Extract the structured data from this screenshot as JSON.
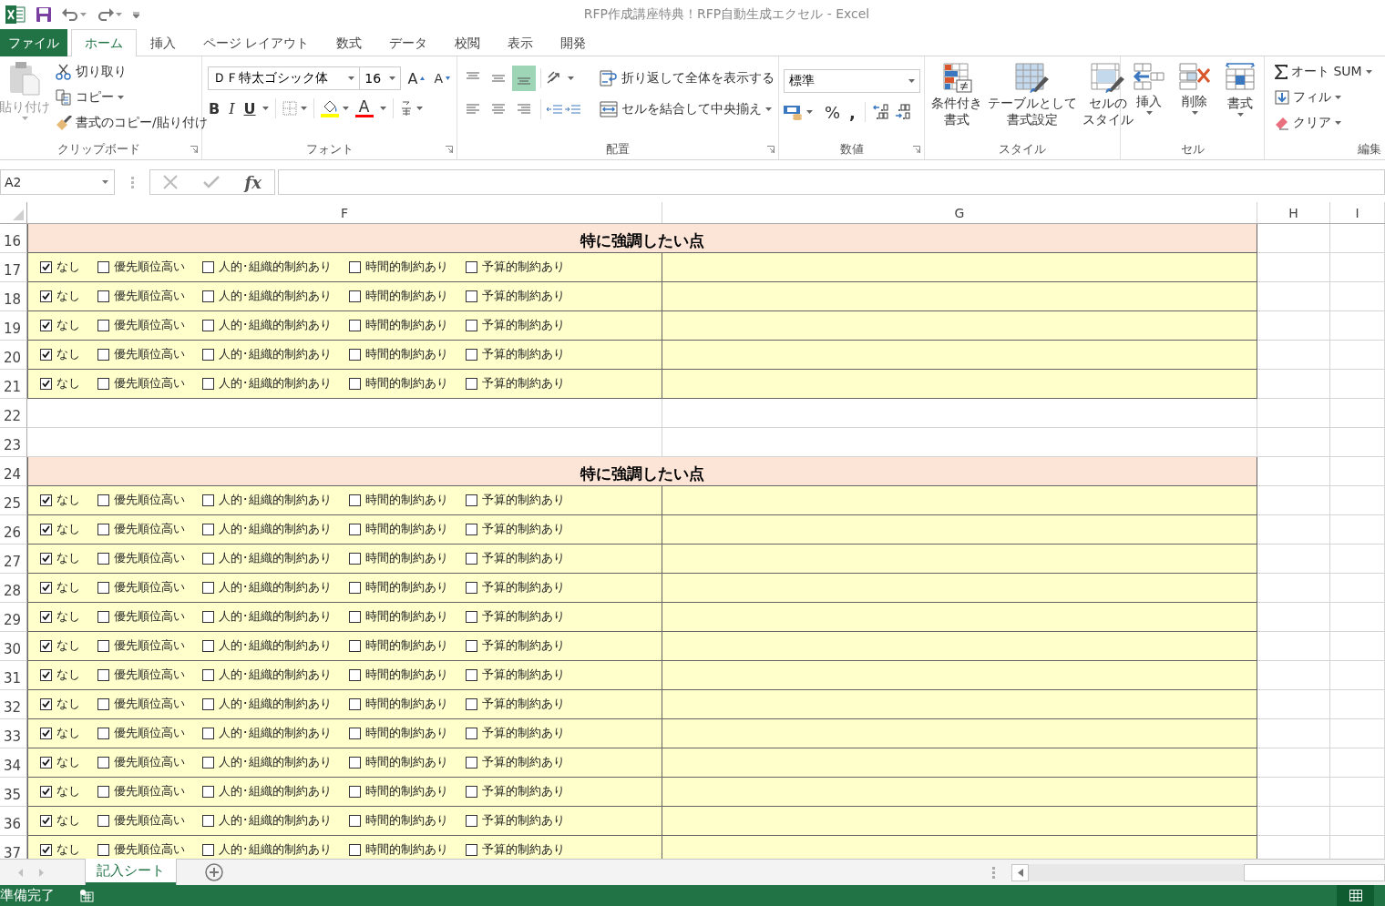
{
  "title_bar": {
    "title": "RFP作成講座特典！RFP自動生成エクセル - Excel"
  },
  "ribbon_tabs": [
    {
      "label": "ファイル",
      "kind": "file",
      "selected": false
    },
    {
      "label": "ホーム",
      "kind": "tab",
      "selected": true
    },
    {
      "label": "挿入",
      "kind": "tab",
      "selected": false
    },
    {
      "label": "ページ レイアウト",
      "kind": "tab",
      "selected": false
    },
    {
      "label": "数式",
      "kind": "tab",
      "selected": false
    },
    {
      "label": "データ",
      "kind": "tab",
      "selected": false
    },
    {
      "label": "校閲",
      "kind": "tab",
      "selected": false
    },
    {
      "label": "表示",
      "kind": "tab",
      "selected": false
    },
    {
      "label": "開発",
      "kind": "tab",
      "selected": false
    }
  ],
  "ribbon": {
    "clipboard": {
      "paste": {
        "label": "貼り付け",
        "disabled": true
      },
      "cut": "切り取り",
      "copy": "コピー",
      "format_painter": "書式のコピー/貼り付け",
      "label": "クリップボード"
    },
    "font": {
      "font_name": "ＤＦ特太ゴシック体",
      "font_size": "16",
      "grow_font": "A",
      "shrink_font": "A",
      "bold": "B",
      "italic": "I",
      "underline": "U",
      "font_color": "A",
      "label": "フォント"
    },
    "alignment": {
      "vertical_align": [
        {
          "selected": false
        },
        {
          "selected": false
        },
        {
          "selected": true
        }
      ],
      "wrap_text": "折り返して全体を表示する",
      "merge_center": "セルを結合して中央揃え",
      "label": "配置"
    },
    "number": {
      "format": "標準",
      "percent": "%",
      "comma": ",",
      "label": "数値"
    },
    "styles": {
      "buttons": [
        {
          "lines": [
            "条件付き",
            "書式"
          ],
          "kind": "conditional"
        },
        {
          "lines": [
            "テーブルとして",
            "書式設定"
          ],
          "kind": "table"
        },
        {
          "lines": [
            "セルの",
            "スタイル"
          ],
          "kind": "cellstyle"
        }
      ],
      "label": "スタイル"
    },
    "cells": {
      "buttons": [
        {
          "label": "挿入",
          "kind": "insert"
        },
        {
          "label": "削除",
          "kind": "delete"
        },
        {
          "label": "書式",
          "kind": "format"
        }
      ],
      "label": "セル"
    },
    "editing": {
      "autosum": "オート SUM",
      "fill": "フィル",
      "clear": "クリア",
      "label": "編集"
    }
  },
  "formula_bar": {
    "name_box": "A2",
    "function_label": "fx"
  },
  "columns": [
    {
      "label": "F"
    },
    {
      "label": "G"
    },
    {
      "label": "H"
    },
    {
      "label": "I"
    }
  ],
  "rows": [
    {
      "number": "16",
      "kind": "heading",
      "text": "特に強調したい点"
    },
    {
      "number": "17",
      "kind": "checks",
      "options": [
        {
          "label": "なし",
          "checked": true
        },
        {
          "label": "優先順位高い",
          "checked": false
        },
        {
          "label": "人的･組織的制約あり",
          "checked": false
        },
        {
          "label": "時間的制約あり",
          "checked": false
        },
        {
          "label": "予算的制約あり",
          "checked": false
        }
      ]
    },
    {
      "number": "18",
      "kind": "checks",
      "options": [
        {
          "label": "なし",
          "checked": true
        },
        {
          "label": "優先順位高い",
          "checked": false
        },
        {
          "label": "人的･組織的制約あり",
          "checked": false
        },
        {
          "label": "時間的制約あり",
          "checked": false
        },
        {
          "label": "予算的制約あり",
          "checked": false
        }
      ]
    },
    {
      "number": "19",
      "kind": "checks",
      "options": [
        {
          "label": "なし",
          "checked": true
        },
        {
          "label": "優先順位高い",
          "checked": false
        },
        {
          "label": "人的･組織的制約あり",
          "checked": false
        },
        {
          "label": "時間的制約あり",
          "checked": false
        },
        {
          "label": "予算的制約あり",
          "checked": false
        }
      ]
    },
    {
      "number": "20",
      "kind": "checks",
      "options": [
        {
          "label": "なし",
          "checked": true
        },
        {
          "label": "優先順位高い",
          "checked": false
        },
        {
          "label": "人的･組織的制約あり",
          "checked": false
        },
        {
          "label": "時間的制約あり",
          "checked": false
        },
        {
          "label": "予算的制約あり",
          "checked": false
        }
      ]
    },
    {
      "number": "21",
      "kind": "checks",
      "options": [
        {
          "label": "なし",
          "checked": true
        },
        {
          "label": "優先順位高い",
          "checked": false
        },
        {
          "label": "人的･組織的制約あり",
          "checked": false
        },
        {
          "label": "時間的制約あり",
          "checked": false
        },
        {
          "label": "予算的制約あり",
          "checked": false
        }
      ]
    },
    {
      "number": "22",
      "kind": "empty"
    },
    {
      "number": "23",
      "kind": "empty"
    },
    {
      "number": "24",
      "kind": "heading",
      "text": "特に強調したい点"
    },
    {
      "number": "25",
      "kind": "checks",
      "options": [
        {
          "label": "なし",
          "checked": true
        },
        {
          "label": "優先順位高い",
          "checked": false
        },
        {
          "label": "人的･組織的制約あり",
          "checked": false
        },
        {
          "label": "時間的制約あり",
          "checked": false
        },
        {
          "label": "予算的制約あり",
          "checked": false
        }
      ]
    },
    {
      "number": "26",
      "kind": "checks",
      "options": [
        {
          "label": "なし",
          "checked": true
        },
        {
          "label": "優先順位高い",
          "checked": false
        },
        {
          "label": "人的･組織的制約あり",
          "checked": false
        },
        {
          "label": "時間的制約あり",
          "checked": false
        },
        {
          "label": "予算的制約あり",
          "checked": false
        }
      ]
    },
    {
      "number": "27",
      "kind": "checks",
      "options": [
        {
          "label": "なし",
          "checked": true
        },
        {
          "label": "優先順位高い",
          "checked": false
        },
        {
          "label": "人的･組織的制約あり",
          "checked": false
        },
        {
          "label": "時間的制約あり",
          "checked": false
        },
        {
          "label": "予算的制約あり",
          "checked": false
        }
      ]
    },
    {
      "number": "28",
      "kind": "checks",
      "options": [
        {
          "label": "なし",
          "checked": true
        },
        {
          "label": "優先順位高い",
          "checked": false
        },
        {
          "label": "人的･組織的制約あり",
          "checked": false
        },
        {
          "label": "時間的制約あり",
          "checked": false
        },
        {
          "label": "予算的制約あり",
          "checked": false
        }
      ]
    },
    {
      "number": "29",
      "kind": "checks",
      "options": [
        {
          "label": "なし",
          "checked": true
        },
        {
          "label": "優先順位高い",
          "checked": false
        },
        {
          "label": "人的･組織的制約あり",
          "checked": false
        },
        {
          "label": "時間的制約あり",
          "checked": false
        },
        {
          "label": "予算的制約あり",
          "checked": false
        }
      ]
    },
    {
      "number": "30",
      "kind": "checks",
      "options": [
        {
          "label": "なし",
          "checked": true
        },
        {
          "label": "優先順位高い",
          "checked": false
        },
        {
          "label": "人的･組織的制約あり",
          "checked": false
        },
        {
          "label": "時間的制約あり",
          "checked": false
        },
        {
          "label": "予算的制約あり",
          "checked": false
        }
      ]
    },
    {
      "number": "31",
      "kind": "checks",
      "options": [
        {
          "label": "なし",
          "checked": true
        },
        {
          "label": "優先順位高い",
          "checked": false
        },
        {
          "label": "人的･組織的制約あり",
          "checked": false
        },
        {
          "label": "時間的制約あり",
          "checked": false
        },
        {
          "label": "予算的制約あり",
          "checked": false
        }
      ]
    },
    {
      "number": "32",
      "kind": "checks",
      "options": [
        {
          "label": "なし",
          "checked": true
        },
        {
          "label": "優先順位高い",
          "checked": false
        },
        {
          "label": "人的･組織的制約あり",
          "checked": false
        },
        {
          "label": "時間的制約あり",
          "checked": false
        },
        {
          "label": "予算的制約あり",
          "checked": false
        }
      ]
    },
    {
      "number": "33",
      "kind": "checks",
      "options": [
        {
          "label": "なし",
          "checked": true
        },
        {
          "label": "優先順位高い",
          "checked": false
        },
        {
          "label": "人的･組織的制約あり",
          "checked": false
        },
        {
          "label": "時間的制約あり",
          "checked": false
        },
        {
          "label": "予算的制約あり",
          "checked": false
        }
      ]
    },
    {
      "number": "34",
      "kind": "checks",
      "options": [
        {
          "label": "なし",
          "checked": true
        },
        {
          "label": "優先順位高い",
          "checked": false
        },
        {
          "label": "人的･組織的制約あり",
          "checked": false
        },
        {
          "label": "時間的制約あり",
          "checked": false
        },
        {
          "label": "予算的制約あり",
          "checked": false
        }
      ]
    },
    {
      "number": "35",
      "kind": "checks",
      "options": [
        {
          "label": "なし",
          "checked": true
        },
        {
          "label": "優先順位高い",
          "checked": false
        },
        {
          "label": "人的･組織的制約あり",
          "checked": false
        },
        {
          "label": "時間的制約あり",
          "checked": false
        },
        {
          "label": "予算的制約あり",
          "checked": false
        }
      ]
    },
    {
      "number": "36",
      "kind": "checks",
      "options": [
        {
          "label": "なし",
          "checked": true
        },
        {
          "label": "優先順位高い",
          "checked": false
        },
        {
          "label": "人的･組織的制約あり",
          "checked": false
        },
        {
          "label": "時間的制約あり",
          "checked": false
        },
        {
          "label": "予算的制約あり",
          "checked": false
        }
      ]
    },
    {
      "number": "37",
      "kind": "checks",
      "options": [
        {
          "label": "なし",
          "checked": true
        },
        {
          "label": "優先順位高い",
          "checked": false
        },
        {
          "label": "人的･組織的制約あり",
          "checked": false
        },
        {
          "label": "時間的制約あり",
          "checked": false
        },
        {
          "label": "予算的制約あり",
          "checked": false
        }
      ]
    }
  ],
  "sheet_tabs": [
    {
      "label": "記入シート",
      "selected": true
    }
  ],
  "status_bar": {
    "text": "準備完了"
  }
}
